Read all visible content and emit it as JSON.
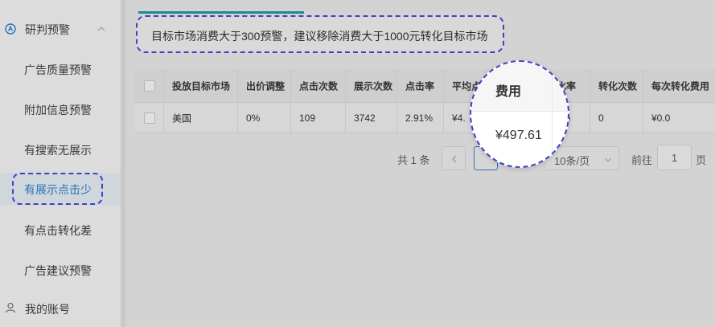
{
  "sidebar": {
    "group_label": "研判预警",
    "items": [
      {
        "label": "广告质量预警"
      },
      {
        "label": "附加信息预警"
      },
      {
        "label": "有搜索无展示"
      },
      {
        "label": "有展示点击少"
      },
      {
        "label": "有点击转化差"
      },
      {
        "label": "广告建议预警"
      }
    ],
    "account_label": "我的账号"
  },
  "alert": {
    "text": "目标市场消费大于300预警，建议移除消费大于1000元转化目标市场"
  },
  "table": {
    "columns": [
      "投放目标市场",
      "出价调整",
      "点击次数",
      "展示次数",
      "点击率",
      "平均点",
      "费用",
      "化率",
      "转化次数",
      "每次转化费用"
    ],
    "row": [
      "美国",
      "0%",
      "109",
      "3742",
      "2.91%",
      "¥4.",
      "",
      "0%",
      "0",
      "¥0.0"
    ]
  },
  "pagination": {
    "total": "共 1 条",
    "current_page": "1",
    "page_size": "10条/页",
    "goto_label": "前往",
    "goto_value": "1",
    "page_suffix": "页"
  },
  "magnifier": {
    "header": "费用",
    "value": "¥497.61"
  },
  "colors": {
    "accent": "#2a72b8",
    "highlight_border": "#4040cc",
    "tab_accent": "#1f8a8a"
  }
}
